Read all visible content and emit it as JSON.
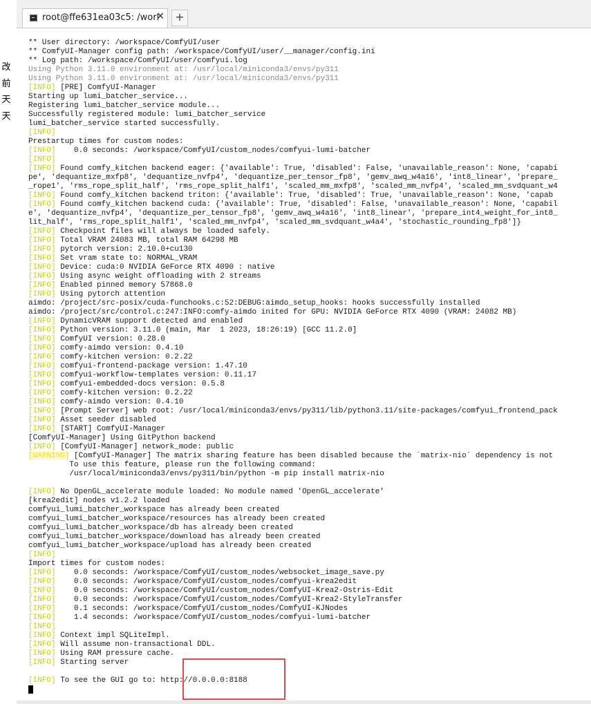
{
  "side_chars": [
    "改",
    "前",
    "天",
    "天"
  ],
  "tab": {
    "title": "root@ffe631ea03c5: /work",
    "close": "✕",
    "new": "+"
  },
  "terminal_lines": [
    {
      "text": "** User directory: /workspace/ComfyUI/user"
    },
    {
      "text": "** ComfyUI-Manager config path: /workspace/ComfyUI/user/__manager/config.ini"
    },
    {
      "text": "** Log path: /workspace/ComfyUI/user/comfyui.log"
    },
    {
      "text": "Using Python 3.11.0 environment at: /usr/local/miniconda3/envs/py311",
      "dim": true
    },
    {
      "text": "Using Python 3.11.0 environment at: /usr/local/miniconda3/envs/py311",
      "dim": true
    },
    {
      "tag": "[INFO]",
      "text": " [PRE] ComfyUI-Manager"
    },
    {
      "text": "Starting up lumi_batcher_service..."
    },
    {
      "text": "Registering lumi_batcher_service module..."
    },
    {
      "text": "Successfully registered module: lumi_batcher_service"
    },
    {
      "text": "lumi_batcher_service started successfully."
    },
    {
      "tag": "[INFO]",
      "text": ""
    },
    {
      "text": "Prestartup times for custom nodes:"
    },
    {
      "tag": "[INFO]",
      "text": "    0.0 seconds: /workspace/ComfyUI/custom_nodes/comfyui-lumi-batcher"
    },
    {
      "tag": "[INFO]",
      "text": ""
    },
    {
      "tag": "[INFO]",
      "text": " Found comfy_kitchen backend eager: {'available': True, 'disabled': False, 'unavailable_reason': None, 'capabi"
    },
    {
      "text": "pe', 'dequantize_mxfp8', 'dequantize_nvfp4', 'dequantize_per_tensor_fp8', 'gemv_awq_w4a16', 'int8_linear', 'prepare_"
    },
    {
      "text": "_rope1', 'rms_rope_split_half', 'rms_rope_split_half1', 'scaled_mm_mxfp8', 'scaled_mm_nvfp4', 'scaled_mm_svdquant_w4"
    },
    {
      "tag": "[INFO]",
      "text": " Found comfy_kitchen backend triton: {'available': True, 'disabled': True, 'unavailable_reason': None, 'capab"
    },
    {
      "tag": "[INFO]",
      "text": " Found comfy_kitchen backend cuda: {'available': True, 'disabled': False, 'unavailable_reason': None, 'capabil"
    },
    {
      "text": "e', 'dequantize_nvfp4', 'dequantize_per_tensor_fp8', 'gemv_awq_w4a16', 'int8_linear', 'prepare_int4_weight_for_int8_"
    },
    {
      "text": "lit_half', 'rms_rope_split_half1', 'scaled_mm_nvfp4', 'scaled_mm_svdquant_w4a4', 'stochastic_rounding_fp8']}"
    },
    {
      "tag": "[INFO]",
      "text": " Checkpoint files will always be loaded safely."
    },
    {
      "tag": "[INFO]",
      "text": " Total VRAM 24083 MB, total RAM 64298 MB"
    },
    {
      "tag": "[INFO]",
      "text": " pytorch version: 2.10.0+cu130"
    },
    {
      "tag": "[INFO]",
      "text": " Set vram state to: NORMAL_VRAM"
    },
    {
      "tag": "[INFO]",
      "text": " Device: cuda:0 NVIDIA GeForce RTX 4090 : native"
    },
    {
      "tag": "[INFO]",
      "text": " Using async weight offloading with 2 streams"
    },
    {
      "tag": "[INFO]",
      "text": " Enabled pinned memory 57868.0"
    },
    {
      "tag": "[INFO]",
      "text": " Using pytorch attention"
    },
    {
      "text": "aimdo: /project/src-posix/cuda-funchooks.c:52:DEBUG:aimdo_setup_hooks: hooks successfully installed"
    },
    {
      "text": "aimdo: /project/src/control.c:247:INFO:comfy-aimdo inited for GPU: NVIDIA GeForce RTX 4090 (VRAM: 24082 MB)"
    },
    {
      "tag": "[INFO]",
      "text": " DynamicVRAM support detected and enabled"
    },
    {
      "tag": "[INFO]",
      "text": " Python version: 3.11.0 (main, Mar  1 2023, 18:26:19) [GCC 11.2.0]"
    },
    {
      "tag": "[INFO]",
      "text": " ComfyUI version: 0.28.0"
    },
    {
      "tag": "[INFO]",
      "text": " comfy-aimdo version: 0.4.10"
    },
    {
      "tag": "[INFO]",
      "text": " comfy-kitchen version: 0.2.22"
    },
    {
      "tag": "[INFO]",
      "text": " comfyui-frontend-package version: 1.47.10"
    },
    {
      "tag": "[INFO]",
      "text": " comfyui-workflow-templates version: 0.11.17"
    },
    {
      "tag": "[INFO]",
      "text": " comfyui-embedded-docs version: 0.5.8"
    },
    {
      "tag": "[INFO]",
      "text": " comfy-kitchen version: 0.2.22"
    },
    {
      "tag": "[INFO]",
      "text": " comfy-aimdo version: 0.4.10"
    },
    {
      "tag": "[INFO]",
      "text": " [Prompt Server] web root: /usr/local/miniconda3/envs/py311/lib/python3.11/site-packages/comfyui_frontend_pack"
    },
    {
      "tag": "[INFO]",
      "text": " Asset seeder disabled"
    },
    {
      "tag": "[INFO]",
      "text": " [START] ComfyUI-Manager"
    },
    {
      "text": "[ComfyUI-Manager] Using GitPython backend"
    },
    {
      "tag": "[INFO]",
      "text": " [ComfyUI-Manager] network_mode: public"
    },
    {
      "tag": "[WARNING]",
      "warn": true,
      "text": " [ComfyUI-Manager] The matrix sharing feature has been disabled because the `matrix-nio` dependency is not"
    },
    {
      "text": "         To use this feature, please run the following command:"
    },
    {
      "text": "         /usr/local/miniconda3/envs/py311/bin/python -m pip install matrix-nio"
    },
    {
      "text": ""
    },
    {
      "tag": "[INFO]",
      "text": " No OpenGL_accelerate module loaded: No module named 'OpenGL_accelerate'"
    },
    {
      "text": "[krea2edit] nodes v1.2.2 loaded"
    },
    {
      "text": "comfyui_lumi_batcher_workspace has already been created"
    },
    {
      "text": "comfyui_lumi_batcher_workspace/resources has already been created"
    },
    {
      "text": "comfyui_lumi_batcher_workspace/db has already been created"
    },
    {
      "text": "comfyui_lumi_batcher_workspace/download has already been created"
    },
    {
      "text": "comfyui_lumi_batcher_workspace/upload has already been created"
    },
    {
      "tag": "[INFO]",
      "text": ""
    },
    {
      "text": "Import times for custom nodes:"
    },
    {
      "tag": "[INFO]",
      "text": "    0.0 seconds: /workspace/ComfyUI/custom_nodes/websocket_image_save.py"
    },
    {
      "tag": "[INFO]",
      "text": "    0.0 seconds: /workspace/ComfyUI/custom_nodes/comfyui-krea2edit"
    },
    {
      "tag": "[INFO]",
      "text": "    0.0 seconds: /workspace/ComfyUI/custom_nodes/ComfyUI-Krea2-Ostris-Edit"
    },
    {
      "tag": "[INFO]",
      "text": "    0.0 seconds: /workspace/ComfyUI/custom_nodes/ComfyUI-Krea2-StyleTransfer"
    },
    {
      "tag": "[INFO]",
      "text": "    0.1 seconds: /workspace/ComfyUI/custom_nodes/ComfyUI-KJNodes"
    },
    {
      "tag": "[INFO]",
      "text": "    1.4 seconds: /workspace/ComfyUI/custom_nodes/comfyui-lumi-batcher"
    },
    {
      "tag": "[INFO]",
      "text": ""
    },
    {
      "tag": "[INFO]",
      "text": " Context impl SQLiteImpl."
    },
    {
      "tag": "[INFO]",
      "text": " Will assume non-transactional DDL."
    },
    {
      "tag": "[INFO]",
      "text": " Using RAM pressure cache."
    },
    {
      "tag": "[INFO]",
      "text": " Starting server"
    },
    {
      "text": ""
    },
    {
      "tag": "[INFO]",
      "text": " To see the GUI go to: http://0.0.0.0:8188"
    }
  ],
  "colors": {
    "info_tag": "#c2d500",
    "warning_tag": "#f1e12b",
    "highlight_border": "#e14a4a"
  }
}
